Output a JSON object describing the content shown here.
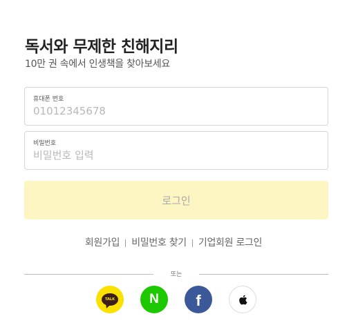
{
  "header": {
    "title": "독서와 무제한 친해지리",
    "subtitle": "10만 권 속에서 인생책을 찾아보세요"
  },
  "form": {
    "phone": {
      "label": "휴대폰 번호",
      "placeholder": "01012345678",
      "value": ""
    },
    "password": {
      "label": "비밀번호",
      "placeholder": "비밀번호 입력",
      "value": ""
    },
    "login_label": "로그인"
  },
  "links": {
    "signup": "회원가입",
    "find_password": "비밀번호 찾기",
    "business_login": "기업회원 로그인"
  },
  "divider": {
    "text": "또는"
  },
  "social": {
    "kakao_text": "TALK",
    "naver_text": "N",
    "facebook_text": "f",
    "icons": [
      "kakao-icon",
      "naver-icon",
      "facebook-icon",
      "apple-icon"
    ]
  },
  "colors": {
    "kakao": "#fae100",
    "naver": "#1ec800",
    "facebook": "#3b5998",
    "login_button_bg": "#fdf5c2"
  }
}
